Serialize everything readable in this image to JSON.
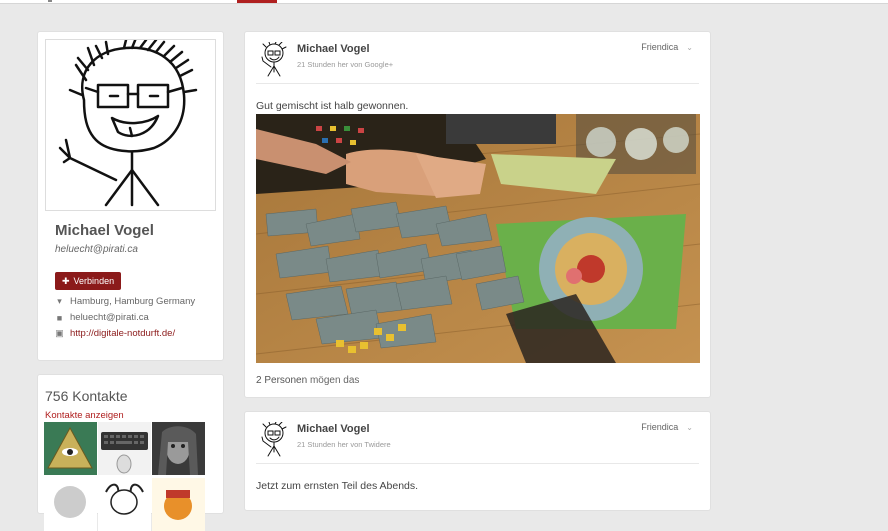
{
  "profile": {
    "name": "Michael Vogel",
    "address": "heluecht@pirati.ca",
    "connect_label": "Verbinden",
    "location": "Hamburg, Hamburg Germany",
    "handle": "heluecht@pirati.ca",
    "homepage": "http://digitale-notdurft.de/"
  },
  "contacts": {
    "title": "756 Kontakte",
    "link_label": "Kontakte anzeigen",
    "thumbnails": [
      "pyramid-eye",
      "keyboard-mouse",
      "portrait-woman",
      "sketch-face",
      "gnu-head",
      "orange-character"
    ]
  },
  "posts": [
    {
      "author": "Michael Vogel",
      "meta": "21 Stunden her von Google+",
      "network": "Friendica",
      "text": "Gut gemischt ist halb gewonnen.",
      "likes_count": "2 Personen",
      "likes_suffix": "mögen das"
    },
    {
      "author": "Michael Vogel",
      "meta": "21 Stunden her von Twidere",
      "network": "Friendica",
      "text": "Jetzt zum ernsten Teil des Abends."
    }
  ],
  "colors": {
    "accent": "#8b1a1a",
    "link": "#b02020",
    "background": "#e9e9e9"
  }
}
